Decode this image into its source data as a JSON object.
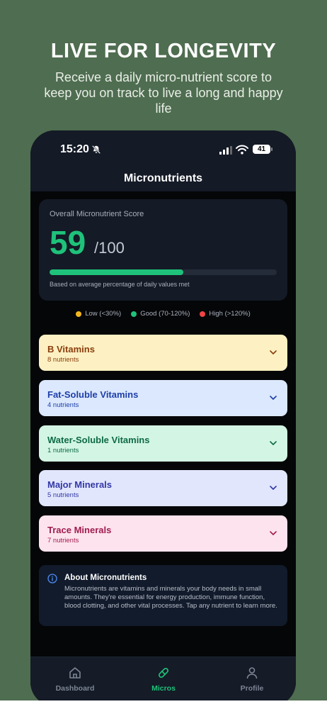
{
  "promo": {
    "headline": "LIVE FOR LONGEVITY",
    "subhead": "Receive a daily micro-nutrient score to keep you on track to live a long and happy life"
  },
  "status": {
    "time": "15:20",
    "battery": "41"
  },
  "screen": {
    "title": "Micronutrients"
  },
  "score": {
    "label": "Overall Micronutrient Score",
    "value": "59",
    "max": "/100",
    "progress_percent": 59,
    "note": "Based on average percentage of daily values met"
  },
  "legend": [
    {
      "label": "Low (<30%)",
      "color": "#f2b71f"
    },
    {
      "label": "Good (70-120%)",
      "color": "#1fc27a"
    },
    {
      "label": "High (>120%)",
      "color": "#ef4444"
    }
  ],
  "categories": [
    {
      "name": "B Vitamins",
      "count": "8 nutrients",
      "bg": "#fdf1c3",
      "fg": "#8a3d0c"
    },
    {
      "name": "Fat-Soluble Vitamins",
      "count": "4 nutrients",
      "bg": "#dbe8fe",
      "fg": "#1e3fa8"
    },
    {
      "name": "Water-Soluble Vitamins",
      "count": "1 nutrients",
      "bg": "#d3f6e4",
      "fg": "#0d6a45"
    },
    {
      "name": "Major Minerals",
      "count": "5 nutrients",
      "bg": "#e1e6fd",
      "fg": "#3237a5"
    },
    {
      "name": "Trace Minerals",
      "count": "7 nutrients",
      "bg": "#fde3ee",
      "fg": "#a11c4e"
    }
  ],
  "about": {
    "title": "About Micronutrients",
    "body": "Micronutrients are vitamins and minerals your body needs in small amounts. They're essential for energy production, immune function, blood clotting, and other vital processes. Tap any nutrient to learn more."
  },
  "tabs": [
    {
      "label": "Dashboard",
      "icon": "home-icon",
      "active": false
    },
    {
      "label": "Micros",
      "icon": "pill-icon",
      "active": true
    },
    {
      "label": "Profile",
      "icon": "user-icon",
      "active": false
    }
  ]
}
